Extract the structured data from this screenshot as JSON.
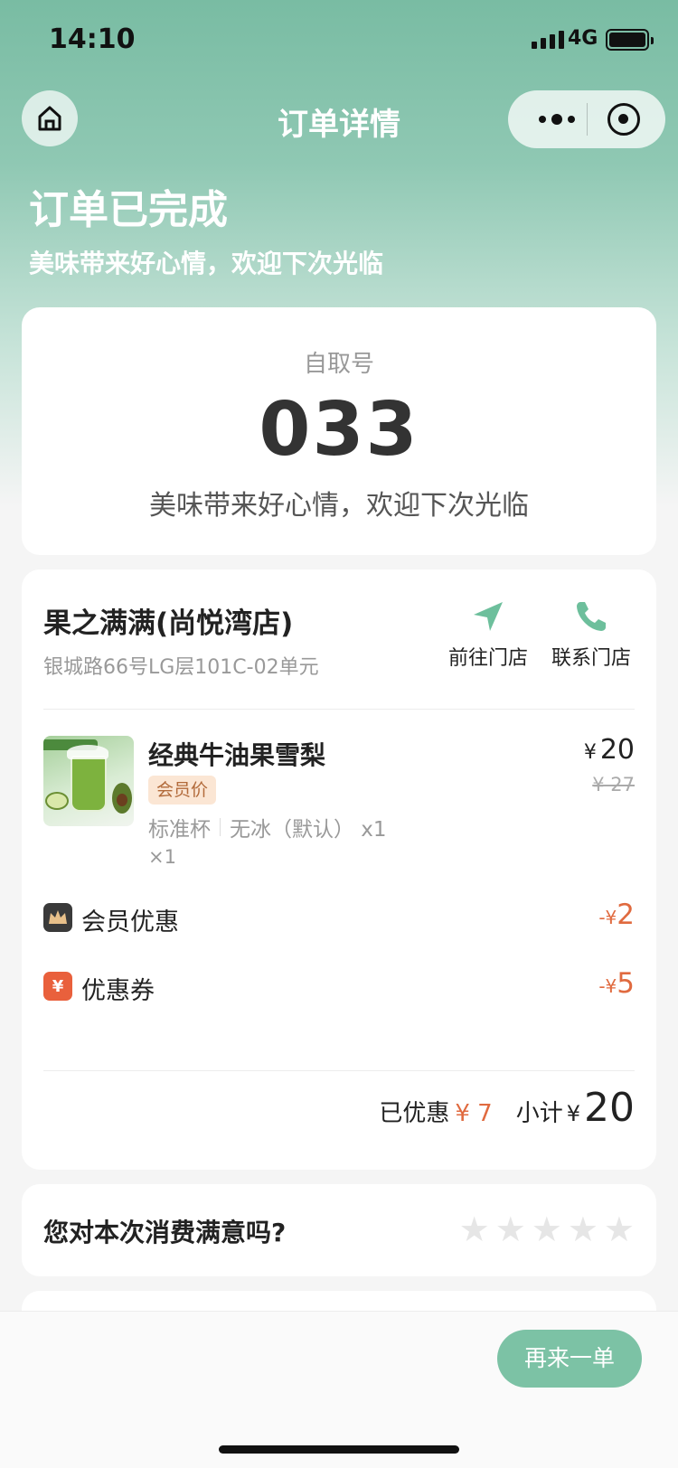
{
  "status_bar": {
    "time": "14:10",
    "network": "4G",
    "icons": [
      "signal-icon",
      "battery-icon"
    ]
  },
  "nav": {
    "title": "订单详情",
    "home_icon": "home-icon",
    "more_icon": "more-dots-icon",
    "close_icon": "record-target-icon"
  },
  "header": {
    "status": "订单已完成",
    "subtitle": "美味带来好心情，欢迎下次光临"
  },
  "pickup": {
    "label": "自取号",
    "number": "033",
    "message": "美味带来好心情，欢迎下次光临"
  },
  "store": {
    "name": "果之满满(尚悦湾店)",
    "address": "银城路66号LG层101C-02单元",
    "navigate_label": "前往门店",
    "contact_label": "联系门店",
    "accent_color": "#6dbf9c"
  },
  "product": {
    "name": "经典牛油果雪梨",
    "tag": "会员价",
    "spec_size": "标准杯",
    "spec_ice": "无冰（默认） x1",
    "qty": "×1",
    "price_symbol": "¥",
    "price": "20",
    "original_price": "¥ 27"
  },
  "discounts": [
    {
      "label": "会员优惠",
      "sign": "-¥",
      "amount": "2",
      "icon": "crown-icon",
      "icon_color": "#3a3a3a"
    },
    {
      "label": "优惠券",
      "sign": "-¥",
      "amount": "5",
      "icon": "coupon-yen-icon",
      "icon_text": "¥",
      "icon_color": "#e9603c"
    }
  ],
  "summary": {
    "saved_label": "已优惠",
    "saved_value": "¥ 7",
    "subtotal_label": "小计",
    "yen": "¥",
    "subtotal_value": "20"
  },
  "rating": {
    "question": "您对本次消费满意吗?",
    "stars": 0,
    "max_stars": 5
  },
  "bottom": {
    "reorder_label": "再来一单",
    "accent_color": "#7cc2a5"
  }
}
